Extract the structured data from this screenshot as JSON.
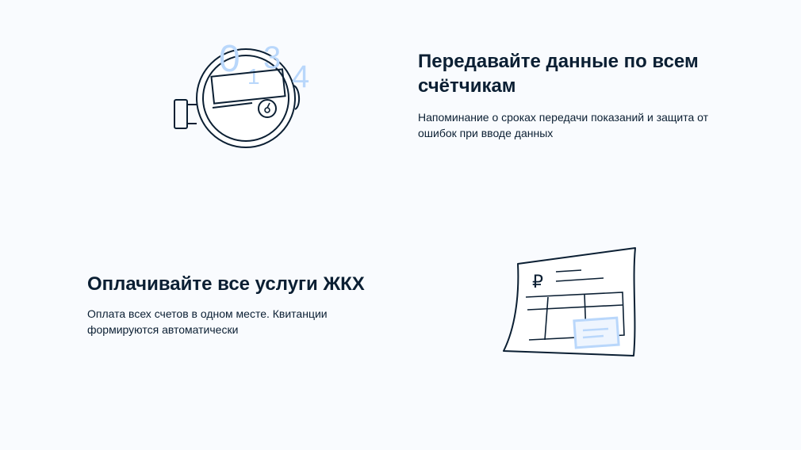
{
  "features": [
    {
      "title": "Передавайте данные по всем счётчикам",
      "description": "Напоминание о сроках передачи показаний и защита от ошибок при вводе данных",
      "icon": "water-meter-icon"
    },
    {
      "title": "Оплачивайте все услуги ЖКХ",
      "description": "Оплата всех счетов в одном месте. Квитанции формируются автоматически",
      "icon": "receipt-icon"
    }
  ],
  "meter_digits": [
    "0",
    "1",
    "3",
    "4"
  ],
  "receipt_currency": "₽",
  "colors": {
    "background": "#f9fbfe",
    "text": "#0b1f33",
    "accent_light_blue": "#b9d7fb",
    "line": "#0b1f33"
  }
}
